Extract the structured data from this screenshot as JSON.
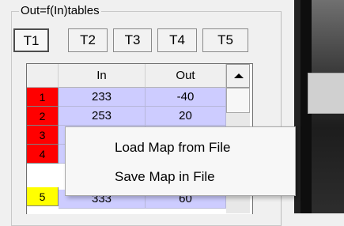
{
  "group": {
    "title": "Out=f(In)tables"
  },
  "tabs": [
    {
      "label": "T1",
      "active": true
    },
    {
      "label": "T2",
      "active": false
    },
    {
      "label": "T3",
      "active": false
    },
    {
      "label": "T4",
      "active": false
    },
    {
      "label": "T5",
      "active": false
    }
  ],
  "table": {
    "columns": [
      "In",
      "Out"
    ],
    "rows": [
      {
        "index": "1",
        "in": "233",
        "out": "-40",
        "color": "#ff0000"
      },
      {
        "index": "2",
        "in": "253",
        "out": "20",
        "color": "#ff0000"
      },
      {
        "index": "3",
        "in": "",
        "out": "",
        "color": "#ff0000"
      },
      {
        "index": "4",
        "in": "",
        "out": "",
        "color": "#ff0000"
      },
      {
        "index": "5",
        "in": "333",
        "out": "60",
        "color": "#ffff00"
      }
    ]
  },
  "context_menu": {
    "items": [
      "Load Map from File",
      "Save Map in File"
    ]
  },
  "icons": {
    "scroll_up": "triangle-up-icon"
  }
}
